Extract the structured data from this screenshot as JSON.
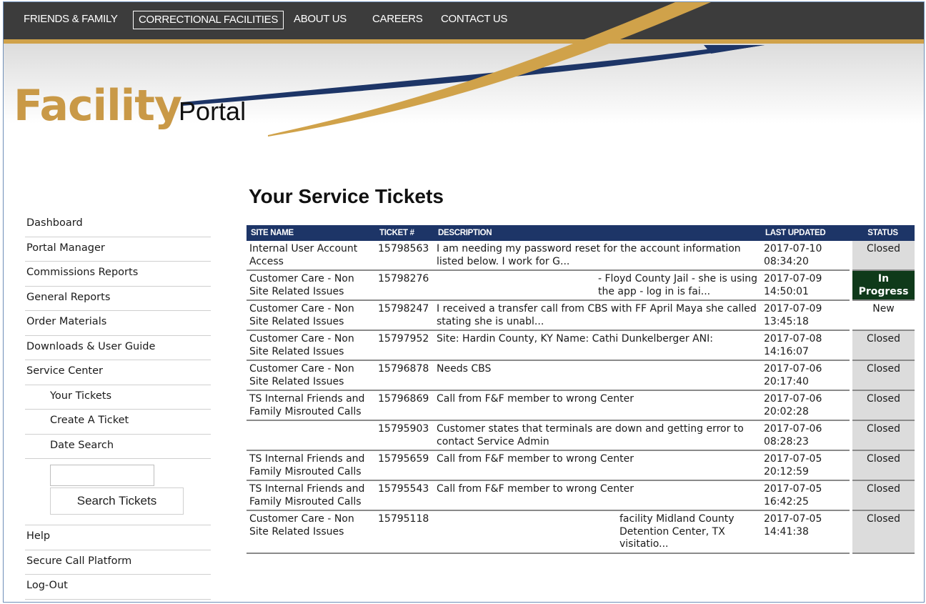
{
  "nav": {
    "items": [
      {
        "label": "FRIENDS & FAMILY"
      },
      {
        "label": "CORRECTIONAL FACILITIES"
      },
      {
        "label": "ABOUT US"
      },
      {
        "label": "CAREERS"
      },
      {
        "label": "CONTACT US"
      }
    ],
    "active": "CORRECTIONAL FACILITIES"
  },
  "logo": {
    "primary": "Facility",
    "secondary": "Portal"
  },
  "colors": {
    "navy": "#1d3567",
    "gold": "#c99947",
    "nav_bg": "#3c3c3c",
    "in_progress_bg": "#0f3a1a",
    "closed_bg": "#dcdcdc"
  },
  "sidebar": {
    "items": [
      {
        "label": "Dashboard"
      },
      {
        "label": "Portal Manager"
      },
      {
        "label": "Commissions Reports"
      },
      {
        "label": "General Reports"
      },
      {
        "label": "Order Materials"
      },
      {
        "label": "Downloads & User Guide"
      },
      {
        "label": "Service Center"
      },
      {
        "label": "Your Tickets"
      },
      {
        "label": "Create A Ticket"
      },
      {
        "label": "Date Search"
      },
      {
        "label": "Help"
      },
      {
        "label": "Secure Call Platform"
      },
      {
        "label": "Log-Out"
      }
    ],
    "search_input_value": "",
    "search_button": "Search Tickets"
  },
  "main": {
    "title": "Your Service Tickets",
    "columns": [
      "SITE NAME",
      "TICKET #",
      "DESCRIPTION",
      "LAST UPDATED",
      "STATUS"
    ],
    "rows": [
      {
        "site": "Internal User Account Access",
        "ticket": "15798563",
        "description": "I am needing my password reset for the account information listed below. I work for G...",
        "date": "2017-07-10",
        "time": "08:34:20",
        "status": "Closed"
      },
      {
        "site": "Customer Care - Non Site Related Issues",
        "ticket": "15798276",
        "description": "- Floyd County Jail - she is using the app - log in is fai...",
        "date": "2017-07-09",
        "time": "14:50:01",
        "status": "In Progress"
      },
      {
        "site": "Customer Care - Non Site Related Issues",
        "ticket": "15798247",
        "description": "I received a transfer call from CBS with FF April Maya she called stating she is unabl...",
        "date": "2017-07-09",
        "time": "13:45:18",
        "status": "New"
      },
      {
        "site": "Customer Care - Non Site Related Issues",
        "ticket": "15797952",
        "description": "Site: Hardin County, KY Name: Cathi Dunkelberger ANI:",
        "date": "2017-07-08",
        "time": "14:16:07",
        "status": "Closed"
      },
      {
        "site": "Customer Care - Non Site Related Issues",
        "ticket": "15796878",
        "description": "Needs CBS",
        "date": "2017-07-06",
        "time": "20:17:40",
        "status": "Closed"
      },
      {
        "site": "TS Internal Friends and Family Misrouted Calls",
        "ticket": "15796869",
        "description": "Call from F&F member to wrong Center",
        "date": "2017-07-06",
        "time": "20:02:28",
        "status": "Closed"
      },
      {
        "site": "",
        "ticket": "15795903",
        "description": "Customer states that terminals are down and getting error to contact Service Admin",
        "date": "2017-07-06",
        "time": "08:28:23",
        "status": "Closed"
      },
      {
        "site": "TS Internal Friends and Family Misrouted Calls",
        "ticket": "15795659",
        "description": "Call from F&F member to wrong Center",
        "date": "2017-07-05",
        "time": "20:12:59",
        "status": "Closed"
      },
      {
        "site": "TS Internal Friends and Family Misrouted Calls",
        "ticket": "15795543",
        "description": "Call from F&F member to wrong Center",
        "date": "2017-07-05",
        "time": "16:42:25",
        "status": "Closed"
      },
      {
        "site": "Customer Care - Non Site Related Issues",
        "ticket": "15795118",
        "description": "facility Midland County Detention Center, TX visitatio...",
        "date": "2017-07-05",
        "time": "14:41:38",
        "status": "Closed"
      }
    ]
  }
}
